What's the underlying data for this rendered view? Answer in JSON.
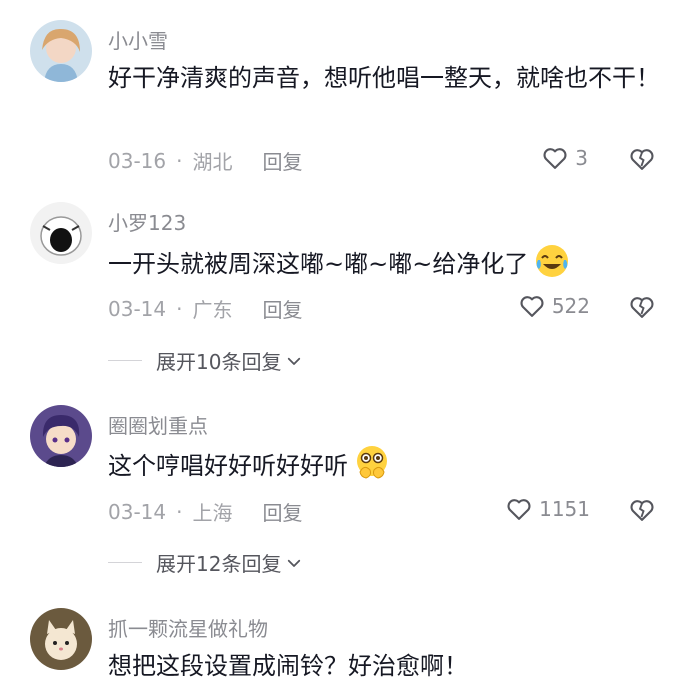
{
  "comments": [
    {
      "username": "小小雪",
      "text": "好干净清爽的声音，想听他唱一整天，就啥也不干！",
      "date": "03-16",
      "location": "湖北",
      "reply_label": "回复",
      "likes": "3"
    },
    {
      "username": "小罗123",
      "text": "一开头就被周深这嘟~嘟~嘟~给净化了",
      "emoji": "crying-laughing-emoji",
      "date": "03-14",
      "location": "广东",
      "reply_label": "回复",
      "likes": "522",
      "expand_label": "展开10条回复"
    },
    {
      "username": "圈圈划重点",
      "text": "这个哼唱好好听好好听",
      "emoji": "pleading-hands-emoji",
      "date": "03-14",
      "location": "上海",
      "reply_label": "回复",
      "likes": "1151",
      "expand_label": "展开12条回复"
    },
    {
      "username": "抓一颗流星做礼物",
      "text": "想把这段设置成闹铃？好治愈啊！"
    }
  ],
  "separator": "·",
  "colors": {
    "text": "#161823",
    "username": "#8a8b91",
    "meta": "#a2a3a8",
    "icon": "#55565d"
  }
}
